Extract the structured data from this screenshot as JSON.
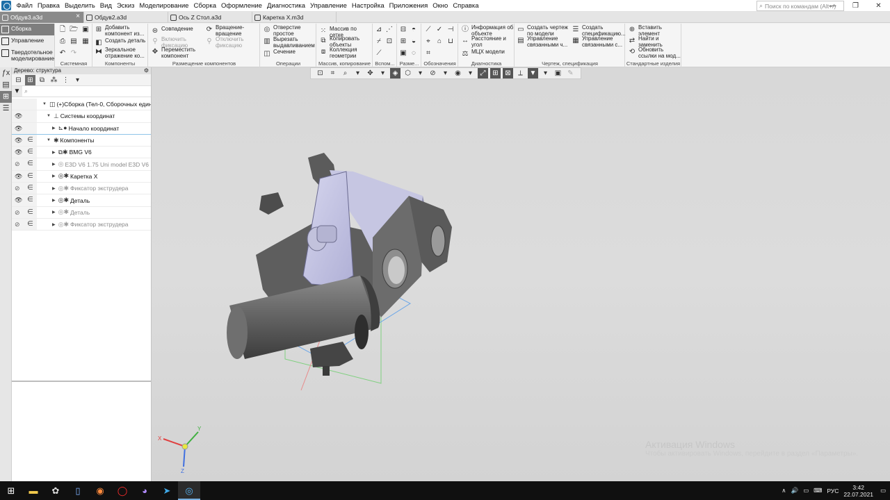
{
  "menu": [
    "Файл",
    "Правка",
    "Выделить",
    "Вид",
    "Эскиз",
    "Моделирование",
    "Сборка",
    "Оформление",
    "Диагностика",
    "Управление",
    "Настройка",
    "Приложения",
    "Окно",
    "Справка"
  ],
  "search_placeholder": "Поиск по командам (Alt+/)",
  "tabs": [
    {
      "label": "Обдув3.a3d",
      "close": "×"
    },
    {
      "label": "Обдув2.a3d"
    },
    {
      "label": "Ось Z Стол.a3d"
    },
    {
      "label": "Каретка X.m3d"
    }
  ],
  "modes": [
    "Сборка",
    "Управление",
    "Твердотельное моделирование"
  ],
  "ribbon": {
    "groups": [
      "Системная",
      "Компоненты",
      "Размещение компонентов",
      "Операции",
      "Массив, копирование",
      "Вспом...",
      "Разме...",
      "Обозначения",
      "Диагностика",
      "Чертеж, спецификация",
      "Стандартные изделия"
    ],
    "add_component": "Добавить компонент из...",
    "create_part": "Создать деталь",
    "mirror": "Зеркальное отражение ко...",
    "coincidence": "Совпадение",
    "enable_fix": "Включить фиксацию",
    "move_comp": "Переместить компонент",
    "rotation": "Вращение-вращение",
    "disable_fix": "Отключить фиксацию",
    "hole": "Отверстие простое",
    "cut_extrude": "Вырезать выдавливанием",
    "section": "Сечение",
    "grid_array": "Массив по сетке",
    "copy_objects": "Копировать объекты",
    "geom_collection": "Коллекция геометрии",
    "obj_info": "Информация об объекте",
    "dist_angle": "Расстояние и угол",
    "mcx": "МЦХ модели",
    "create_drawing": "Создать чертеж по модели",
    "manage_linked": "Управление связанными ч...",
    "create_spec": "Создать спецификацию...",
    "manage_linked_s": "Управление связанными с...",
    "insert_elem": "Вставить элемент",
    "find_replace": "Найти и заменить",
    "update_links": "Обновить ссылки на мод..."
  },
  "tree": {
    "title": "Дерево: структура",
    "rows": [
      {
        "label": "(+)Сборка (Тел-0, Сборочных единиц",
        "dim": false
      },
      {
        "label": "Системы координат",
        "dim": false
      },
      {
        "label": "Начало координат",
        "dim": false
      },
      {
        "label": "Компоненты",
        "dim": false
      },
      {
        "label": "BMG V6",
        "dim": false
      },
      {
        "label": "E3D V6 1.75 Uni model E3D V6 1.",
        "dim": true
      },
      {
        "label": "Каретка X",
        "dim": false
      },
      {
        "label": "Фиксатор экструдера",
        "dim": true
      },
      {
        "label": "Деталь",
        "dim": false
      },
      {
        "label": "Деталь",
        "dim": true
      },
      {
        "label": "Фиксатор экструдера",
        "dim": true
      }
    ]
  },
  "watermark": {
    "title": "Активация Windows",
    "subtitle": "Чтобы активировать Windows, перейдите в раздел «Параметры»."
  },
  "axis_labels": {
    "x": "X",
    "y": "Y",
    "z": "Z"
  },
  "taskbar": {
    "lang": "РУС",
    "time": "3:42",
    "date": "22.07.2021"
  }
}
